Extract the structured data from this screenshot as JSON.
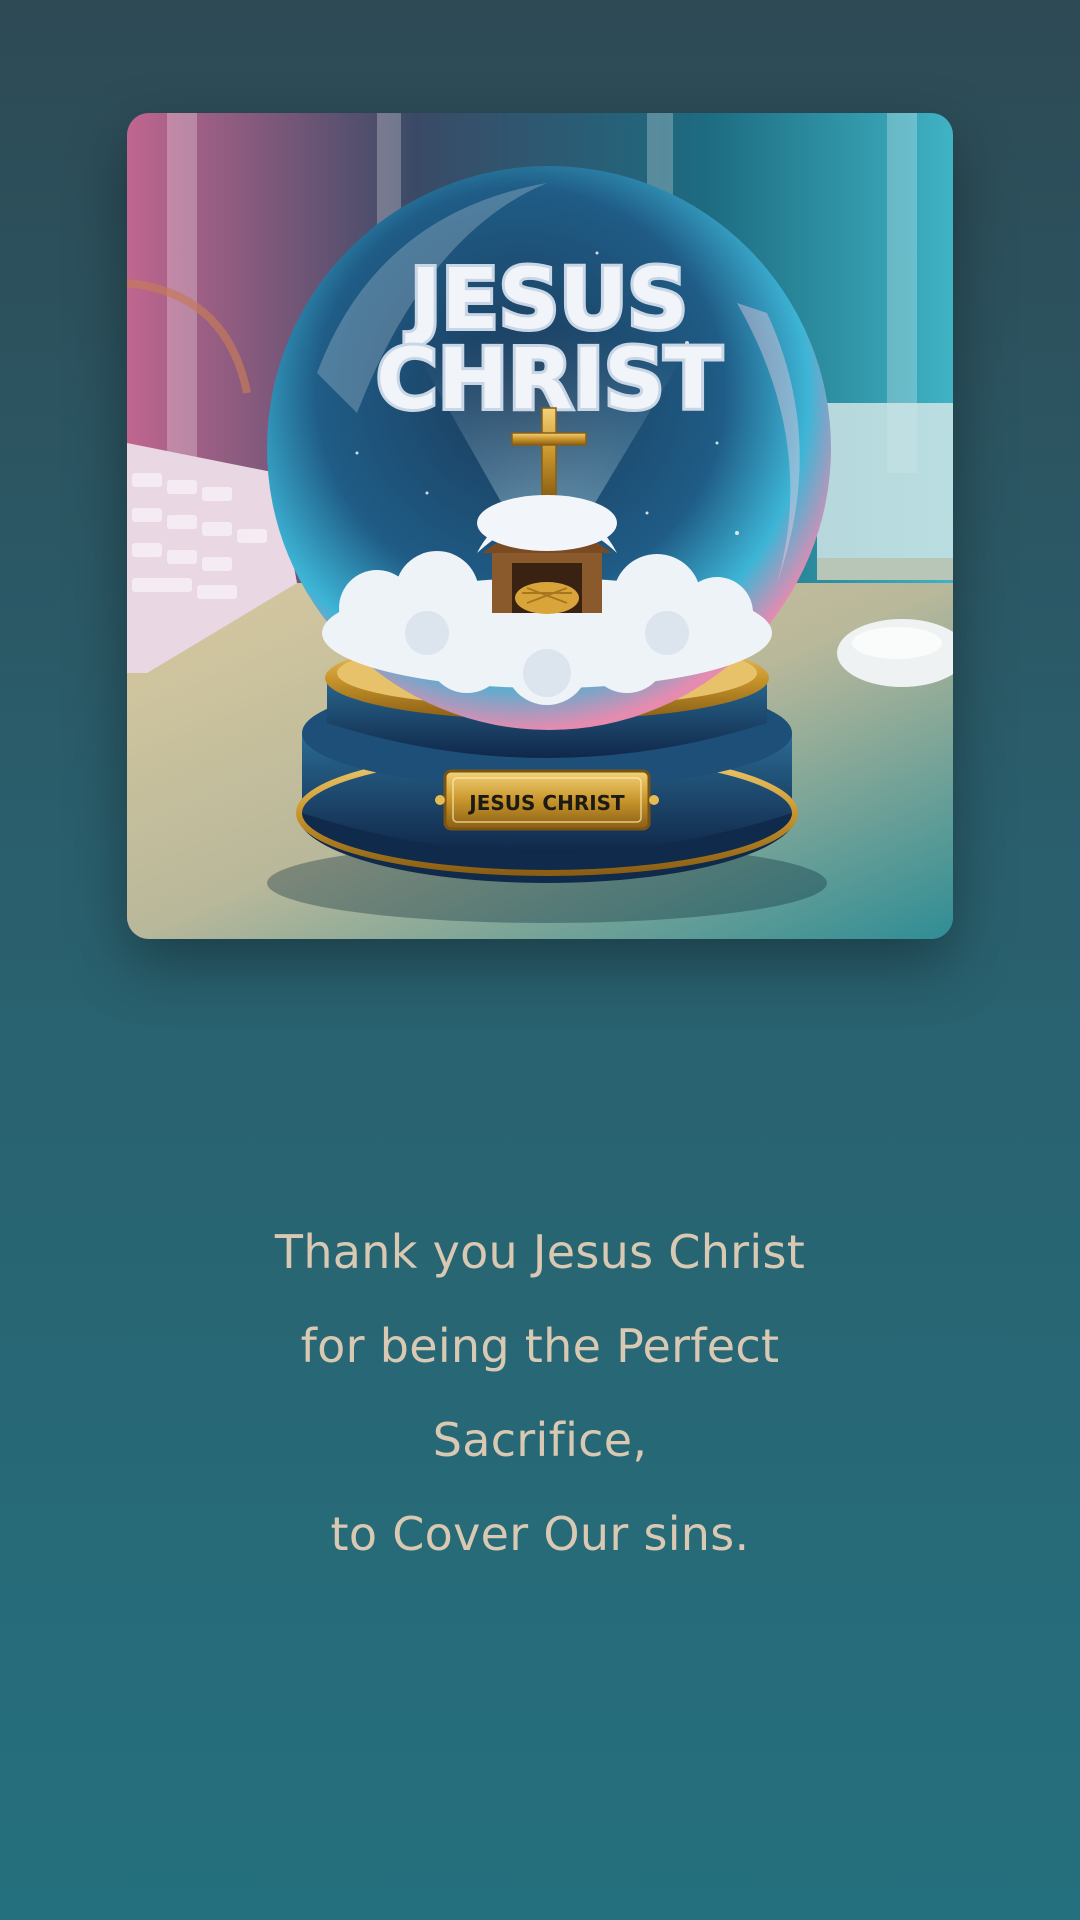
{
  "image": {
    "alt_icon": "snow-globe-icon",
    "globe_title_line1": "JESUS",
    "globe_title_line2": "CHRIST",
    "plaque_text": "JESUS CHRIST"
  },
  "message": {
    "line1": "Thank you Jesus Christ",
    "line2": "for being the Perfect",
    "line3": "Sacrifice,",
    "line4": "to Cover Our sins."
  },
  "colors": {
    "background_top": "#2d4a55",
    "background_bottom": "#25707e",
    "text": "#d9c9b3",
    "gold": "#c9a23a"
  }
}
